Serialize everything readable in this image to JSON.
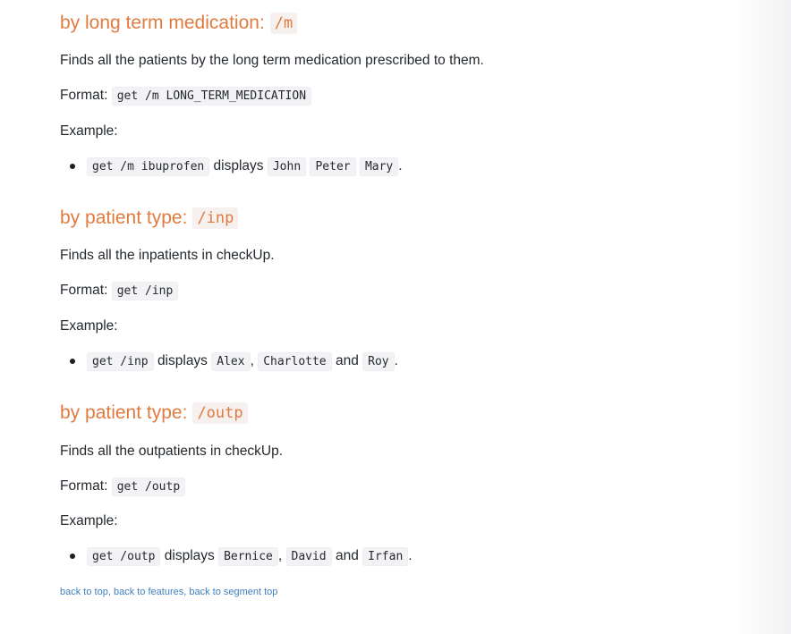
{
  "sections": [
    {
      "heading_text": "by long term medication:",
      "heading_code": "/m",
      "description": "Finds all the patients by the long term medication prescribed to them.",
      "format_label": "Format:",
      "format_code": "get /m LONG_TERM_MEDICATION",
      "example_label": "Example:",
      "example": {
        "command": "get /m ibuprofen",
        "displays": "displays",
        "results": [
          "John",
          "Peter",
          "Mary"
        ],
        "sep": [
          "",
          ""
        ],
        "end": "."
      }
    },
    {
      "heading_text": "by patient type:",
      "heading_code": "/inp",
      "description": "Finds all the inpatients in checkUp.",
      "format_label": "Format:",
      "format_code": "get /inp",
      "example_label": "Example:",
      "example": {
        "command": "get /inp",
        "displays": "displays",
        "results": [
          "Alex",
          "Charlotte",
          "Roy"
        ],
        "sep": [
          ",",
          "and"
        ],
        "end": "."
      }
    },
    {
      "heading_text": "by patient type:",
      "heading_code": "/outp",
      "description": "Finds all the outpatients in checkUp.",
      "format_label": "Format:",
      "format_code": "get /outp",
      "example_label": "Example:",
      "example": {
        "command": "get /outp",
        "displays": "displays",
        "results": [
          "Bernice",
          "David",
          "Irfan"
        ],
        "sep": [
          ",",
          "and"
        ],
        "end": "."
      }
    }
  ],
  "footer": {
    "back_to_top": "back to top",
    "back_to_features": "back to features",
    "back_to_segment_top": "back to segment top",
    "comma": ","
  }
}
